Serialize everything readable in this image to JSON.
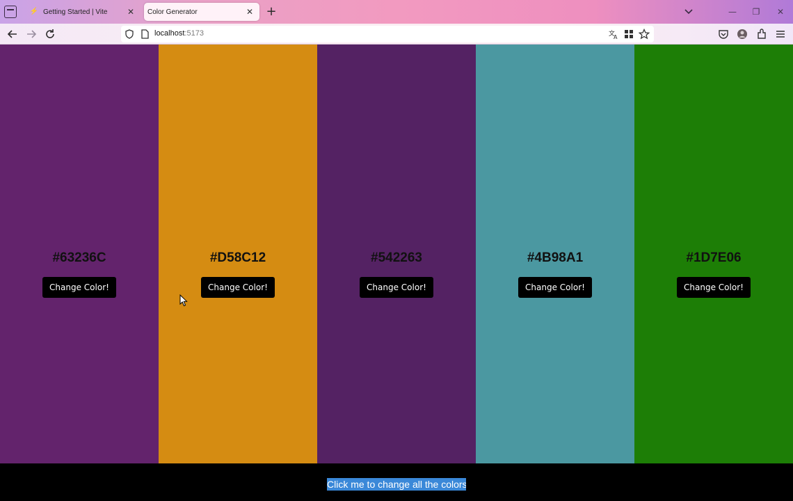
{
  "browser": {
    "tabs": [
      {
        "title": "Getting Started | Vite",
        "favicon": "vite-icon",
        "active": false
      },
      {
        "title": "Color Generator",
        "favicon": "",
        "active": true
      }
    ],
    "new_tab_label": "+",
    "url": {
      "host": "localhost",
      "port": ":5173"
    },
    "icons": {
      "nav": [
        "back-icon",
        "forward-icon",
        "reload-icon"
      ],
      "urlbar": [
        "shield-icon",
        "page-icon",
        "translate-icon",
        "extensions-grid-icon",
        "bookmark-star-icon"
      ],
      "toolbar": [
        "pocket-icon",
        "account-icon",
        "extensions-icon",
        "menu-icon"
      ],
      "window": [
        "minimize-icon",
        "restore-icon",
        "close-icon"
      ]
    }
  },
  "palette": {
    "columns": [
      {
        "hex": "#63236C",
        "color": "#63236C",
        "button_label": "Change Color!"
      },
      {
        "hex": "#D58C12",
        "color": "#D58C12",
        "button_label": "Change Color!"
      },
      {
        "hex": "#542263",
        "color": "#542263",
        "button_label": "Change Color!"
      },
      {
        "hex": "#4B98A1",
        "color": "#4B98A1",
        "button_label": "Change Color!"
      },
      {
        "hex": "#1D7E06",
        "color": "#1D7E06",
        "button_label": "Change Color!"
      }
    ],
    "change_all_label": "Click me to change all the colors!"
  }
}
